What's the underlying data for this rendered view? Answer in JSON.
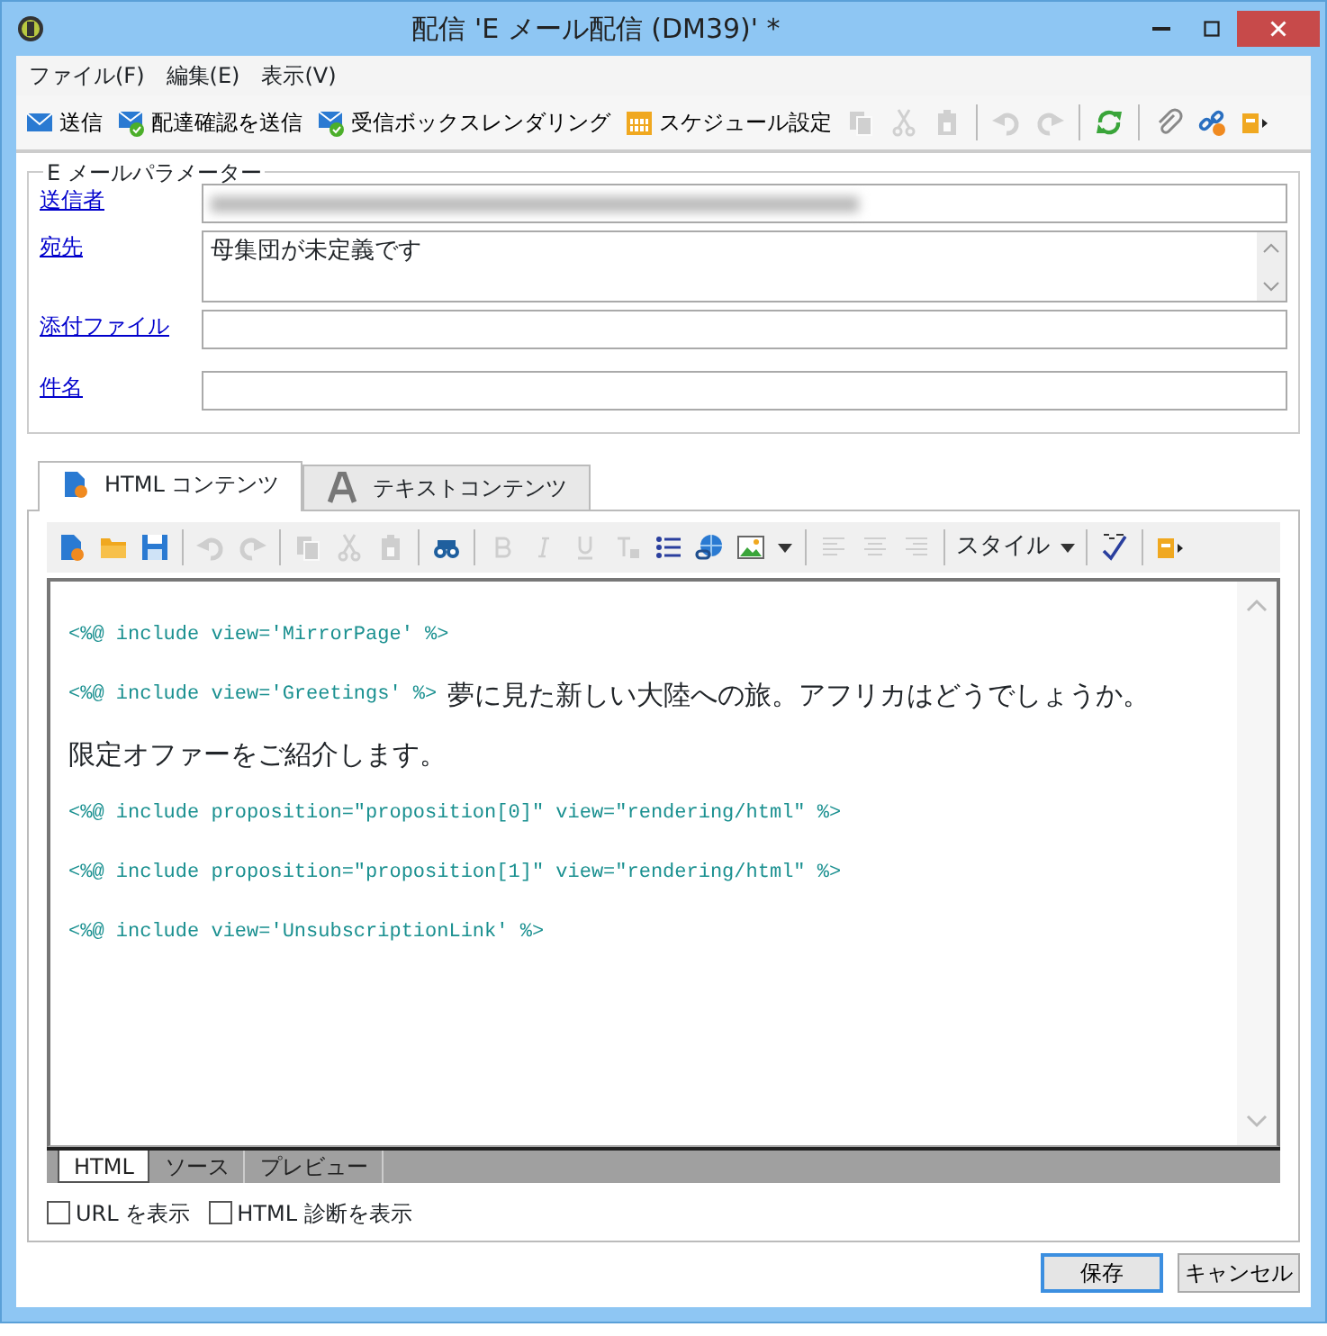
{
  "window": {
    "title": "配信 'E メール配信 (DM39)' *"
  },
  "menu": [
    "ファイル(F)",
    "編集(E)",
    "表示(V)"
  ],
  "toolbar": [
    {
      "kind": "mail",
      "label": "送信",
      "disabled": false
    },
    {
      "kind": "mailcheck",
      "label": "配達確認を送信",
      "disabled": false
    },
    {
      "kind": "mailcheck",
      "label": "受信ボックスレンダリング",
      "disabled": false
    },
    {
      "kind": "calendar",
      "label": "スケジュール設定",
      "disabled": false
    },
    {
      "kind": "copy",
      "disabled": true
    },
    {
      "kind": "cut",
      "disabled": true
    },
    {
      "kind": "paste",
      "disabled": true
    },
    {
      "kind": "sep"
    },
    {
      "kind": "undo",
      "disabled": true
    },
    {
      "kind": "redo",
      "disabled": true
    },
    {
      "kind": "sep"
    },
    {
      "kind": "refresh",
      "disabled": false
    },
    {
      "kind": "sep"
    },
    {
      "kind": "clip",
      "disabled": false
    },
    {
      "kind": "link",
      "disabled": false
    },
    {
      "kind": "more",
      "disabled": false
    }
  ],
  "params": {
    "legend": "E メールパラメーター",
    "fields": [
      {
        "label": "送信者",
        "kind": "line",
        "redacted": true
      },
      {
        "label": "宛先",
        "kind": "area",
        "value": "母集団が未定義です"
      },
      {
        "label": "添付ファイル",
        "kind": "line"
      },
      {
        "label": "件名",
        "kind": "line"
      }
    ]
  },
  "content_tabs": [
    {
      "label": "HTML コンテンツ",
      "kind": "html",
      "selected": true
    },
    {
      "label": "テキストコンテンツ",
      "kind": "text",
      "selected": false
    }
  ],
  "editor_toolbar": [
    {
      "kind": "new",
      "disabled": false
    },
    {
      "kind": "open",
      "disabled": false
    },
    {
      "kind": "save",
      "disabled": false
    },
    {
      "kind": "sep"
    },
    {
      "kind": "undo",
      "disabled": true
    },
    {
      "kind": "redo",
      "disabled": true
    },
    {
      "kind": "sep"
    },
    {
      "kind": "copy",
      "disabled": true
    },
    {
      "kind": "cut",
      "disabled": true
    },
    {
      "kind": "paste",
      "disabled": true
    },
    {
      "kind": "sep"
    },
    {
      "kind": "find",
      "disabled": false
    },
    {
      "kind": "sep"
    },
    {
      "kind": "bold",
      "disabled": true
    },
    {
      "kind": "italic",
      "disabled": true
    },
    {
      "kind": "underline",
      "disabled": true
    },
    {
      "kind": "clearformat",
      "disabled": true
    },
    {
      "kind": "list",
      "disabled": false
    },
    {
      "kind": "globe",
      "disabled": false
    },
    {
      "kind": "image",
      "disabled": false
    },
    {
      "kind": "caret",
      "disabled": false
    },
    {
      "kind": "sep"
    },
    {
      "kind": "alignleft",
      "disabled": true
    },
    {
      "kind": "aligncenter",
      "disabled": true
    },
    {
      "kind": "alignright",
      "disabled": true
    },
    {
      "kind": "sep"
    },
    {
      "kind": "select",
      "label": "スタイル"
    },
    {
      "kind": "sep"
    },
    {
      "kind": "spell",
      "disabled": false
    },
    {
      "kind": "sep"
    },
    {
      "kind": "more",
      "disabled": false
    }
  ],
  "editor_lines": [
    [
      {
        "kind": "code",
        "text": "<%@ include view='MirrorPage' %>"
      }
    ],
    [
      {
        "kind": "code",
        "text": "<%@ include view='Greetings' %>"
      },
      {
        "kind": "text",
        "text": "夢に見た新しい大陸への旅。アフリカはどうでしょうか。"
      }
    ],
    [
      {
        "kind": "text",
        "text": "限定オファーをご紹介します。"
      }
    ],
    [
      {
        "kind": "code",
        "text": "<%@ include proposition=\"proposition[0]\" view=\"rendering/html\" %>"
      }
    ],
    [
      {
        "kind": "code",
        "text": "<%@ include proposition=\"proposition[1]\" view=\"rendering/html\" %>"
      }
    ],
    [
      {
        "kind": "code",
        "text": "<%@ include view='UnsubscriptionLink' %>"
      }
    ]
  ],
  "view_tabs": [
    {
      "label": "HTML",
      "selected": true
    },
    {
      "label": "ソース",
      "selected": false
    },
    {
      "label": "プレビュー",
      "selected": false
    }
  ],
  "options": [
    {
      "label": "URL を表示",
      "checked": false
    },
    {
      "label": "HTML 診断を表示",
      "checked": false
    }
  ],
  "buttons": [
    {
      "label": "保存",
      "default": true
    },
    {
      "label": "キャンセル",
      "default": false
    }
  ]
}
